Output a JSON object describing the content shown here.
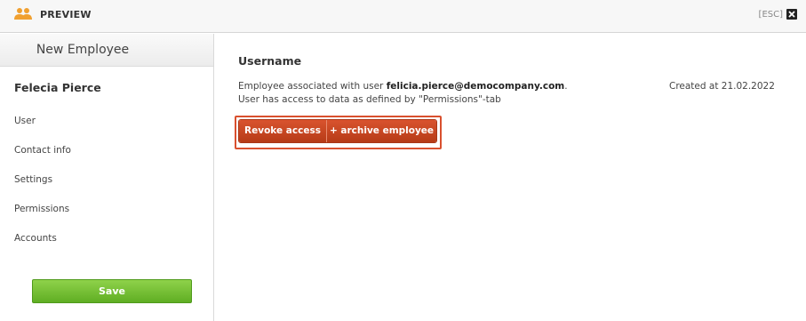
{
  "topbar": {
    "icon": "people-icon",
    "title": "PREVIEW",
    "esc_label": "[ESC]",
    "close_icon": "close-icon",
    "accent_color": "#f0a030"
  },
  "sidebar": {
    "header": "New Employee",
    "employee_name": "Felecia Pierce",
    "items": [
      {
        "label": "User"
      },
      {
        "label": "Contact info"
      },
      {
        "label": "Settings"
      },
      {
        "label": "Permissions"
      },
      {
        "label": "Accounts"
      }
    ],
    "save_label": "Save",
    "save_color": "#6cbf2e"
  },
  "main": {
    "section_title": "Username",
    "assoc_prefix": "Employee associated with user ",
    "assoc_email": "felicia.pierce@democompany.com",
    "assoc_suffix": ".",
    "permissions_text": "User has access to data as defined by \"Permissions\"-tab",
    "created_text": "Created at 21.02.2022",
    "revoke_label": "Revoke access",
    "archive_label": "+ archive employee",
    "action_color": "#c9461f"
  }
}
